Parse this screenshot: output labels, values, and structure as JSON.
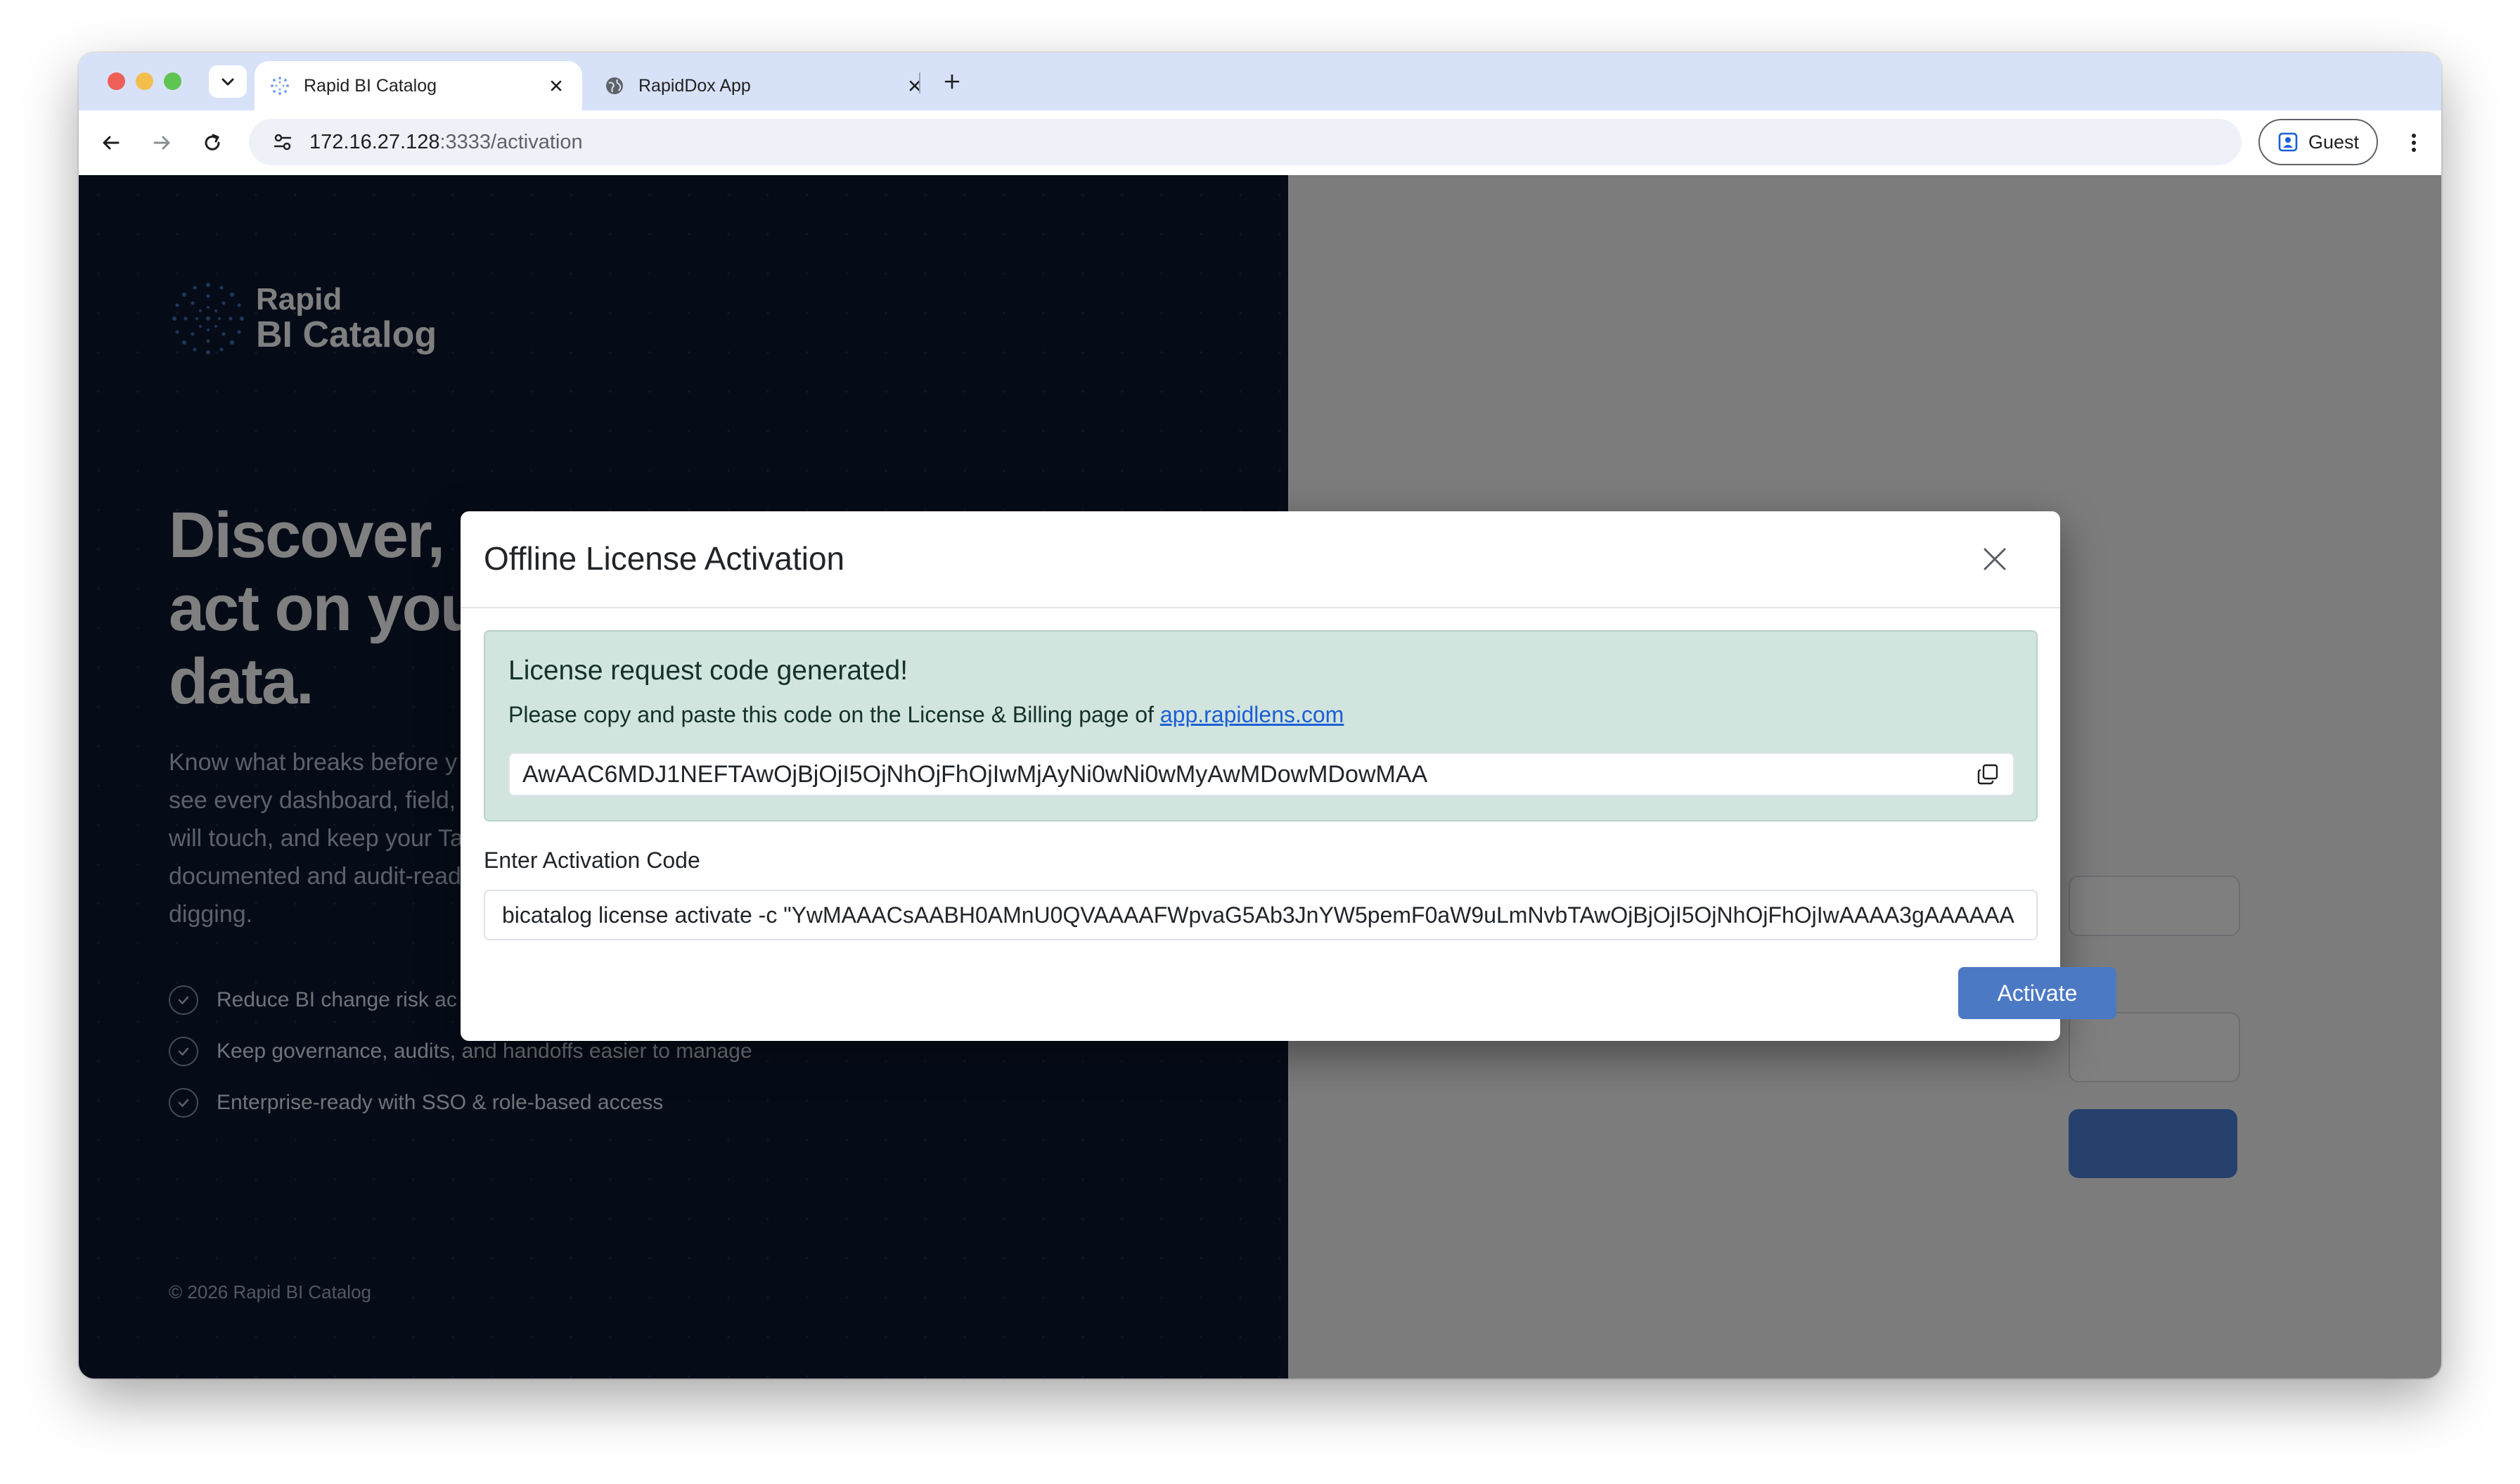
{
  "browser": {
    "tabs": [
      {
        "title": "Rapid BI Catalog",
        "active": true,
        "favicon": "rapid-logo-icon"
      },
      {
        "title": "RapidDox App",
        "active": false,
        "favicon": "globe-icon"
      }
    ],
    "url": {
      "host": "172.16.27.128",
      "path": ":3333/activation"
    },
    "profile_label": "Guest"
  },
  "background_page": {
    "logo": {
      "line1": "Rapid",
      "line2": "BI Catalog"
    },
    "hero": {
      "line1": "Discover, t",
      "line2": "act on you",
      "line3": "data."
    },
    "subtitle_lines": [
      "Know what breaks before y",
      "see every dashboard, field,",
      "will touch, and keep your Ta",
      "documented and audit-read",
      "digging."
    ],
    "benefits": [
      "Reduce BI change risk ac",
      "Keep governance, audits, and handoffs easier to manage",
      "Enterprise-ready with SSO & role-based access"
    ],
    "copyright": "© 2026 Rapid BI Catalog"
  },
  "modal": {
    "title": "Offline License Activation",
    "alert": {
      "heading": "License request code generated!",
      "text": "Please copy and paste this code on the License & Billing page of ",
      "link": "app.rapidlens.com",
      "request_code": "AwAAC6MDJ1NEFTAwOjBjOjI5OjNhOjFhOjIwMjAyNi0wNi0wMyAwMDowMDowMAA"
    },
    "activation_label": "Enter Activation Code",
    "activation_value": "bicatalog license activate -c \"YwMAAACsAABH0AMnU0QVAAAAFWpvaG5Ab3JnYW5pemF0aW9uLmNvbTAwOjBjOjI5OjNhOjFhOjIwAAAA3gAAAAAA",
    "activate_label": "Activate"
  },
  "colors": {
    "left_panel": "#0a1830",
    "modal_alert_bg": "#d2e4de",
    "primary_button": "#4c79c4",
    "tab_strip": "#d7e2f8"
  }
}
